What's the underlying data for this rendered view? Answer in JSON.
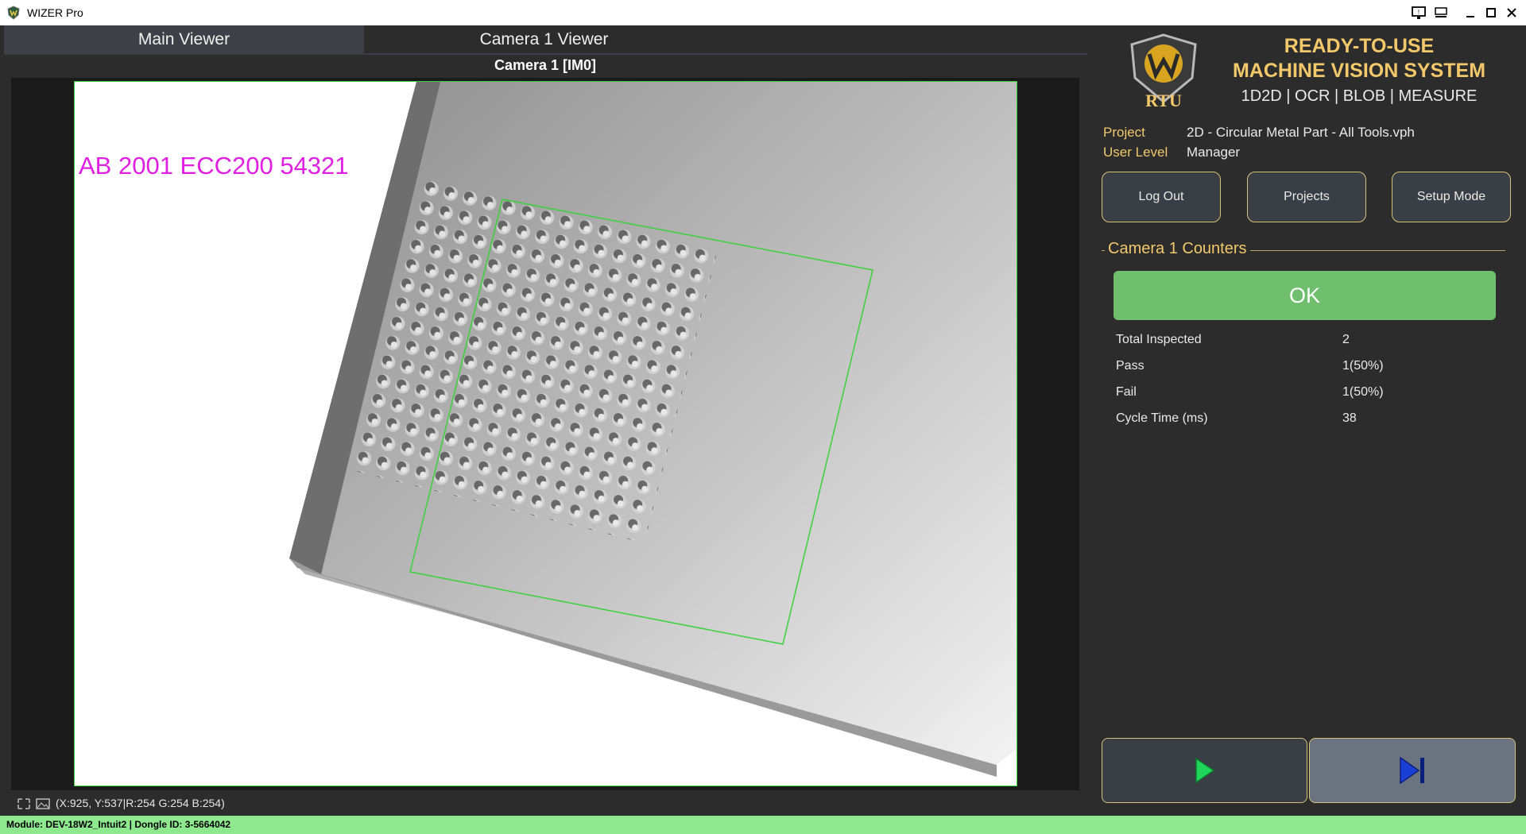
{
  "window": {
    "title": "WIZER Pro",
    "controls": [
      "minimize",
      "maximize",
      "close"
    ]
  },
  "tabs": [
    {
      "label": "Main Viewer",
      "active": true
    },
    {
      "label": "Camera 1 Viewer",
      "active": false
    }
  ],
  "viewer": {
    "camera_label": "Camera 1  [IM0]",
    "ocr_text": "AB 2001 ECC200 54321",
    "coordinates": "(X:925, Y:537|R:254 G:254 B:254)"
  },
  "brand": {
    "logo_text": "RTU",
    "headline_1": "READY-TO-USE",
    "headline_2": "MACHINE VISION SYSTEM",
    "tools": "1D2D | OCR | BLOB | MEASURE"
  },
  "info": {
    "project_label": "Project",
    "project_value": "2D - Circular Metal Part - All Tools.vph",
    "user_label": "User Level",
    "user_value": "Manager"
  },
  "buttons": {
    "logout": "Log Out",
    "projects": "Projects",
    "setup": "Setup Mode"
  },
  "counters": {
    "title": "Camera 1 Counters",
    "status": "OK",
    "rows": [
      {
        "label": "Total Inspected",
        "value": "2"
      },
      {
        "label": "Pass",
        "value": "1(50%)"
      },
      {
        "label": "Fail",
        "value": "1(50%)"
      },
      {
        "label": "Cycle Time (ms)",
        "value": "38"
      }
    ]
  },
  "module_info": "Module: DEV-18W2_Intuit2 | Dongle ID: 3-5664042",
  "colors": {
    "accent_gold": "#f2c86a",
    "ok_green": "#6fbf6f",
    "roi_green": "#3ad13a",
    "ocr_magenta": "#e020e0",
    "module_bar": "#8ee88e"
  },
  "icons": {
    "app": "wizer-shield-icon",
    "play": "play-icon",
    "step": "skip-next-icon",
    "zoom_fit": "fit-view-icon",
    "image": "image-icon"
  }
}
